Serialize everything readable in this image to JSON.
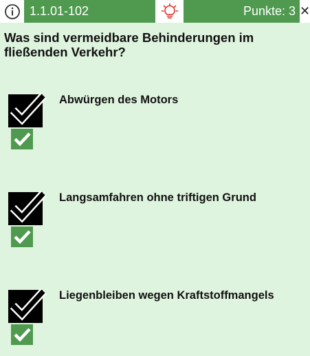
{
  "header": {
    "question_id": "1.1.01-102",
    "points_label": "Punkte: 3",
    "info_icon": "info-icon",
    "hint_icon": "lightbulb-icon",
    "close_icon": "close-icon",
    "accent_color": "#4f9a4f"
  },
  "question": {
    "text": "Was sind vermeidbare Behinderungen im fließenden Verkehr?"
  },
  "answers": [
    {
      "text": "Abwürgen des Motors",
      "selected": true,
      "correct": true
    },
    {
      "text": "Langsamfahren ohne triftigen Grund",
      "selected": true,
      "correct": true
    },
    {
      "text": "Liegenbleiben wegen Kraftstoffmangels",
      "selected": true,
      "correct": true
    }
  ]
}
